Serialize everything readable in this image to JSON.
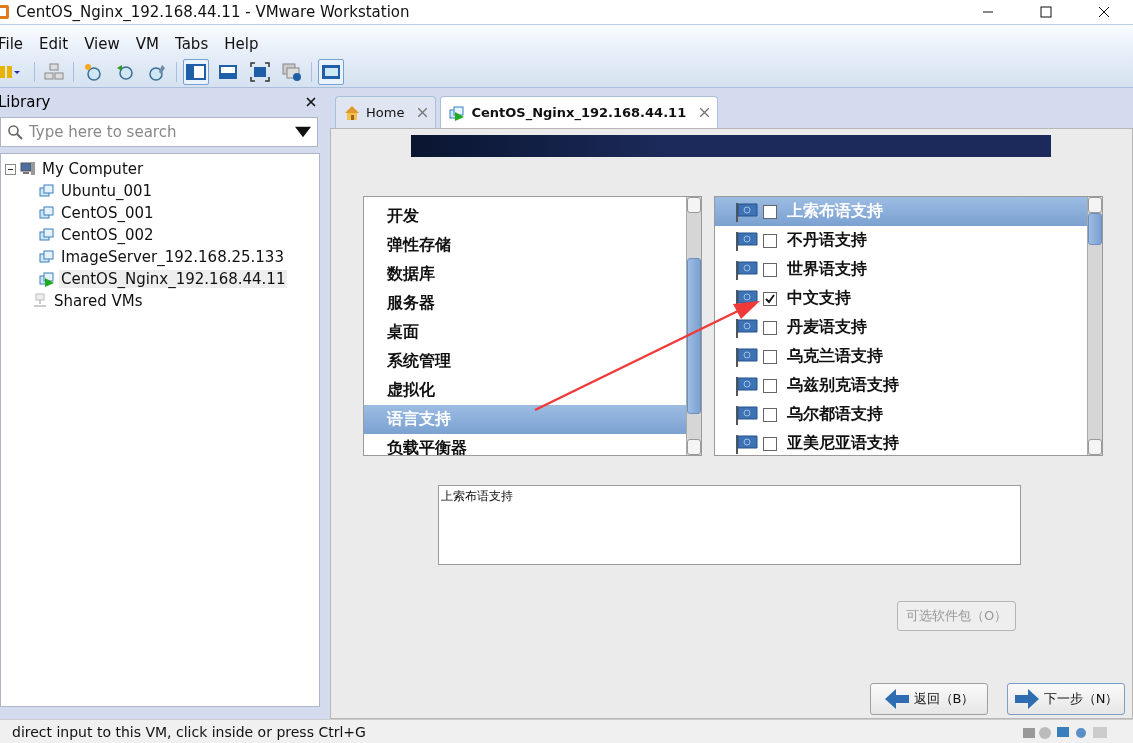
{
  "window": {
    "title": "CentOS_Nginx_192.168.44.11 - VMware Workstation"
  },
  "menu": [
    "File",
    "Edit",
    "View",
    "VM",
    "Tabs",
    "Help"
  ],
  "toolbar": [
    {
      "kind": "power",
      "selected": false
    },
    {
      "kind": "network",
      "selected": false
    },
    {
      "kind": "snapshot",
      "selected": false
    },
    {
      "kind": "revert",
      "selected": false
    },
    {
      "kind": "manage",
      "selected": false
    },
    {
      "kind": "sidebar",
      "selected": true
    },
    {
      "kind": "thumbnail",
      "selected": false
    },
    {
      "kind": "fullscreen",
      "selected": false
    },
    {
      "kind": "unity",
      "selected": false
    },
    {
      "kind": "console",
      "selected": true
    }
  ],
  "library": {
    "title": "Library",
    "search_placeholder": "Type here to search",
    "tree": [
      {
        "label": "My Computer",
        "kind": "computer",
        "expanded": true,
        "children": [
          {
            "label": "Ubuntu_001",
            "kind": "vm",
            "running": false,
            "selected": false
          },
          {
            "label": "CentOS_001",
            "kind": "vm",
            "running": false,
            "selected": false
          },
          {
            "label": "CentOS_002",
            "kind": "vm",
            "running": false,
            "selected": false
          },
          {
            "label": "ImageServer_192.168.25.133",
            "kind": "vm",
            "running": false,
            "selected": false
          },
          {
            "label": "CentOS_Nginx_192.168.44.11",
            "kind": "vm",
            "running": true,
            "selected": true
          }
        ]
      },
      {
        "label": "Shared VMs",
        "kind": "shared"
      }
    ]
  },
  "tabs": [
    {
      "label": "Home",
      "kind": "home",
      "selected": false
    },
    {
      "label": "CentOS_Nginx_192.168.44.11",
      "kind": "vm",
      "selected": true
    }
  ],
  "installer": {
    "categories": [
      {
        "label": "开发",
        "selected": false
      },
      {
        "label": "弹性存储",
        "selected": false
      },
      {
        "label": "数据库",
        "selected": false
      },
      {
        "label": "服务器",
        "selected": false
      },
      {
        "label": "桌面",
        "selected": false
      },
      {
        "label": "系统管理",
        "selected": false
      },
      {
        "label": "虚拟化",
        "selected": false
      },
      {
        "label": "语言支持",
        "selected": true
      },
      {
        "label": "负载平衡器",
        "selected": false
      }
    ],
    "packages": [
      {
        "label": "上索布语支持",
        "checked": false,
        "selected": true
      },
      {
        "label": "不丹语支持",
        "checked": false,
        "selected": false
      },
      {
        "label": "世界语支持",
        "checked": false,
        "selected": false
      },
      {
        "label": "中文支持",
        "checked": true,
        "selected": false
      },
      {
        "label": "丹麦语支持",
        "checked": false,
        "selected": false
      },
      {
        "label": "乌克兰语支持",
        "checked": false,
        "selected": false
      },
      {
        "label": "乌兹别克语支持",
        "checked": false,
        "selected": false
      },
      {
        "label": "乌尔都语支持",
        "checked": false,
        "selected": false
      },
      {
        "label": "亚美尼亚语支持",
        "checked": false,
        "selected": false
      }
    ],
    "description": "上索布语支持",
    "optional_button": {
      "label": "可选软件包（O）",
      "disabled": true
    },
    "back_button": "返回（B）",
    "next_button": "下一步（N）"
  },
  "status_bar": {
    "text": "direct input to this VM, click inside or press Ctrl+G"
  }
}
